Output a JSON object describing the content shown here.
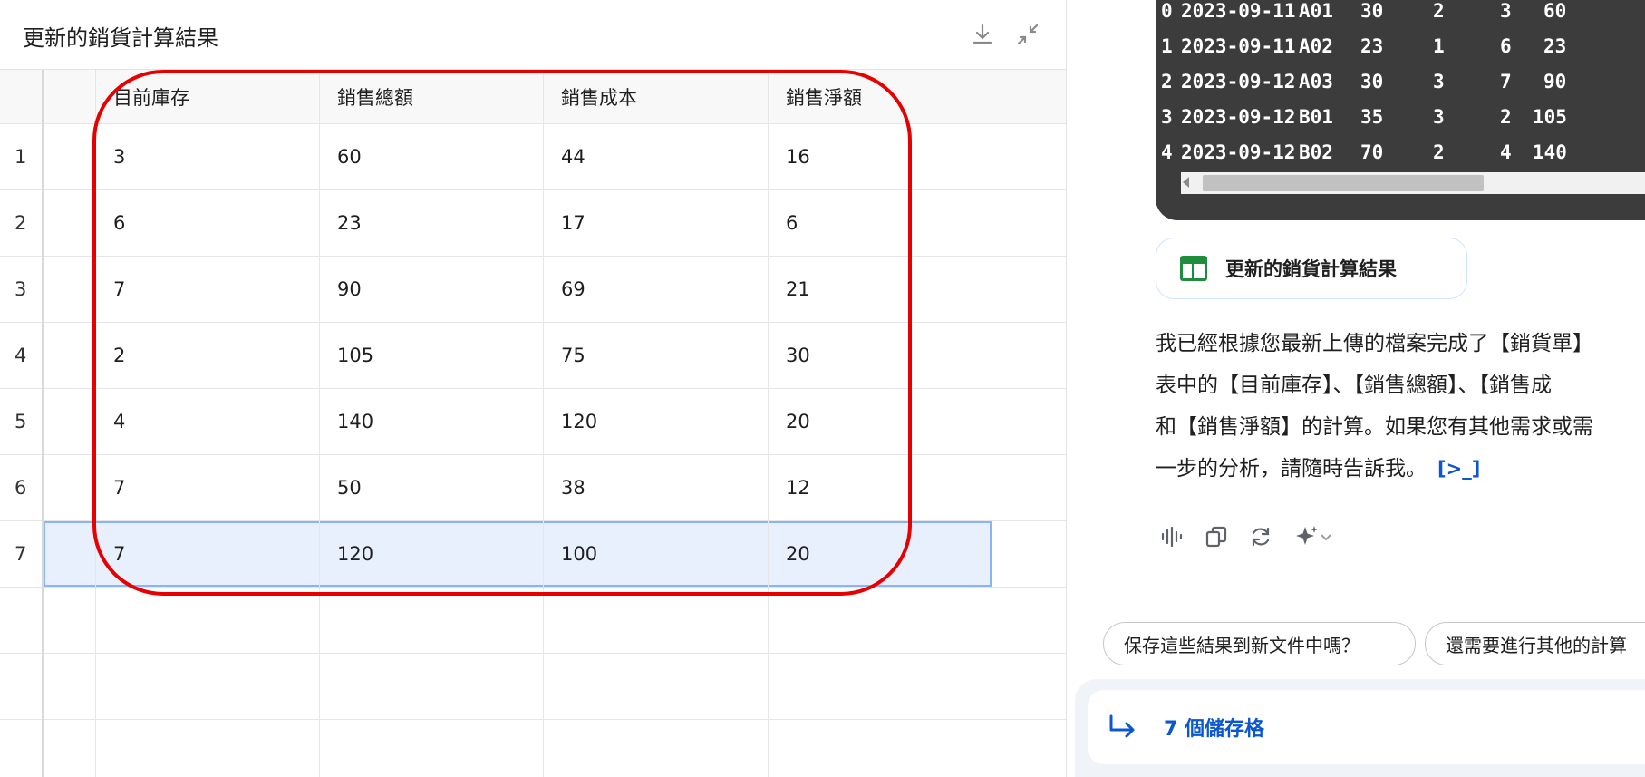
{
  "sheet": {
    "title": "更新的銷貨計算結果",
    "columns": [
      "目前庫存",
      "銷售總額",
      "銷售成本",
      "銷售淨額"
    ],
    "rows": [
      {
        "num": "1",
        "cells": [
          "3",
          "60",
          "44",
          "16"
        ]
      },
      {
        "num": "2",
        "cells": [
          "6",
          "23",
          "17",
          "6"
        ]
      },
      {
        "num": "3",
        "cells": [
          "7",
          "90",
          "69",
          "21"
        ]
      },
      {
        "num": "4",
        "cells": [
          "2",
          "105",
          "75",
          "30"
        ]
      },
      {
        "num": "5",
        "cells": [
          "4",
          "140",
          "120",
          "20"
        ]
      },
      {
        "num": "6",
        "cells": [
          "7",
          "50",
          "38",
          "12"
        ]
      },
      {
        "num": "7",
        "cells": [
          "7",
          "120",
          "100",
          "20"
        ]
      }
    ],
    "selected_row": "7"
  },
  "code_output": {
    "rows": [
      [
        "0",
        "2023-09-11",
        "A01",
        "30",
        "2",
        "3",
        "60"
      ],
      [
        "1",
        "2023-09-11",
        "A02",
        "23",
        "1",
        "6",
        "23"
      ],
      [
        "2",
        "2023-09-12",
        "A03",
        "30",
        "3",
        "7",
        "90"
      ],
      [
        "3",
        "2023-09-12",
        "B01",
        "35",
        "3",
        "2",
        "105"
      ],
      [
        "4",
        "2023-09-12",
        "B02",
        "70",
        "2",
        "4",
        "140"
      ]
    ]
  },
  "chat": {
    "table_chip_label": "更新的銷貨計算結果",
    "response_lines": [
      "我已經根據您最新上傳的檔案完成了【銷貨單】",
      "表中的【目前庫存】、【銷售總額】、【銷售成",
      "和【銷售淨額】的計算。如果您有其他需求或需",
      "一步的分析，請隨時告訴我。"
    ],
    "code_toggle": "[>_]",
    "suggestions": [
      "保存這些結果到新文件中嗎？",
      "還需要進行其他的計算"
    ],
    "selection_label": "7 個儲存格"
  },
  "colors": {
    "accent": "#0b57d0",
    "annotation": "#e60000",
    "sheets_green": "#1e8e3e",
    "selection_bg": "#e9f0fd"
  },
  "icons": [
    "download-icon",
    "collapse-icon",
    "sheets-table-icon",
    "voice-icon",
    "copy-icon",
    "regenerate-icon",
    "sparkle-icon",
    "chevron-down-icon",
    "arrow-return-icon"
  ]
}
